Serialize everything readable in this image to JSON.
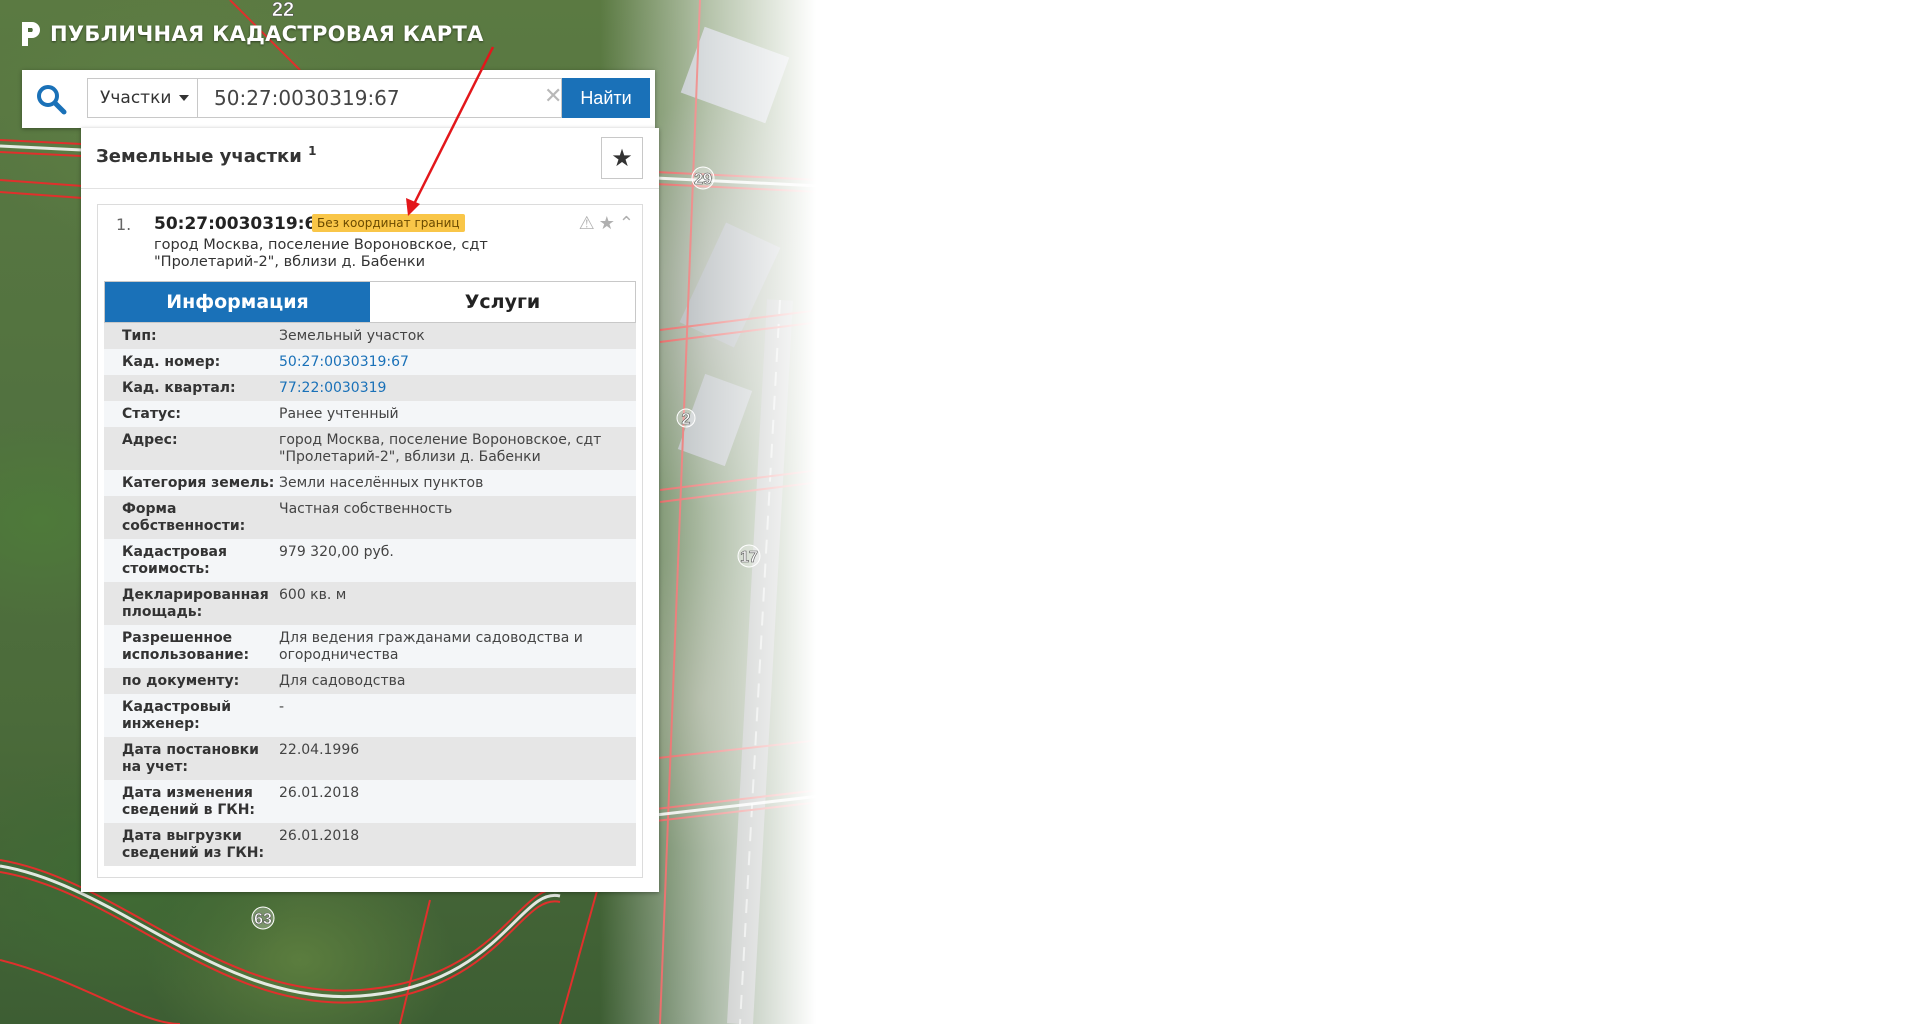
{
  "header": {
    "title": "ПУБЛИЧНАЯ КАДАСТРОВАЯ КАРТА"
  },
  "search": {
    "type_label": "Участки",
    "query": "50:27:0030319:67",
    "clear_glyph": "✕",
    "find_label": "Найти"
  },
  "results": {
    "title": "Земельные участки",
    "count": "1",
    "favorite_glyph": "★"
  },
  "map_labels": [
    "29",
    "2",
    "17",
    "63",
    "22"
  ],
  "item": {
    "index": "1.",
    "cad_number": "50:27:0030319:67",
    "badge": "Без координат границ",
    "address": "город Москва, поселение Вороновское, сдт \"Пролетарий-2\", вблизи д. Бабенки",
    "icons": {
      "warning": "⚠",
      "star": "★",
      "collapse": "⌃"
    },
    "tabs": {
      "info": "Информация",
      "services": "Услуги"
    },
    "fields": [
      {
        "label": "Тип:",
        "value": "Земельный участок",
        "link": false
      },
      {
        "label": "Кад. номер:",
        "value": "50:27:0030319:67",
        "link": true
      },
      {
        "label": "Кад. квартал:",
        "value": "77:22:0030319",
        "link": true
      },
      {
        "label": "Статус:",
        "value": "Ранее учтенный",
        "link": false
      },
      {
        "label": "Адрес:",
        "value": "город Москва, поселение Вороновское, сдт \"Пролетарий-2\", вблизи д. Бабенки",
        "link": false
      },
      {
        "label": "Категория земель:",
        "value": "Земли населённых пунктов",
        "link": false
      },
      {
        "label": "Форма собственности:",
        "value": "Частная собственность",
        "link": false
      },
      {
        "label": "Кадастровая стоимость:",
        "value": "979 320,00 руб.",
        "link": false
      },
      {
        "label": "Декларированная площадь:",
        "value": "600 кв. м",
        "link": false
      },
      {
        "label": "Разрешенное использование:",
        "value": "Для ведения гражданами садоводства и огородничества",
        "link": false
      },
      {
        "label": "по документу:",
        "value": "Для садоводства",
        "link": false
      },
      {
        "label": "Кадастровый инженер:",
        "value": "-",
        "link": false
      },
      {
        "label": "Дата постановки на учет:",
        "value": "22.04.1996",
        "link": false
      },
      {
        "label": "Дата изменения сведений в ГКН:",
        "value": "26.01.2018",
        "link": false
      },
      {
        "label": "Дата выгрузки сведений из ГКН:",
        "value": "26.01.2018",
        "link": false
      }
    ]
  },
  "colors": {
    "accent": "#1a71b8",
    "badge": "#f9c648",
    "arrow": "#e3171b",
    "parcel_line": "#e0302c"
  }
}
